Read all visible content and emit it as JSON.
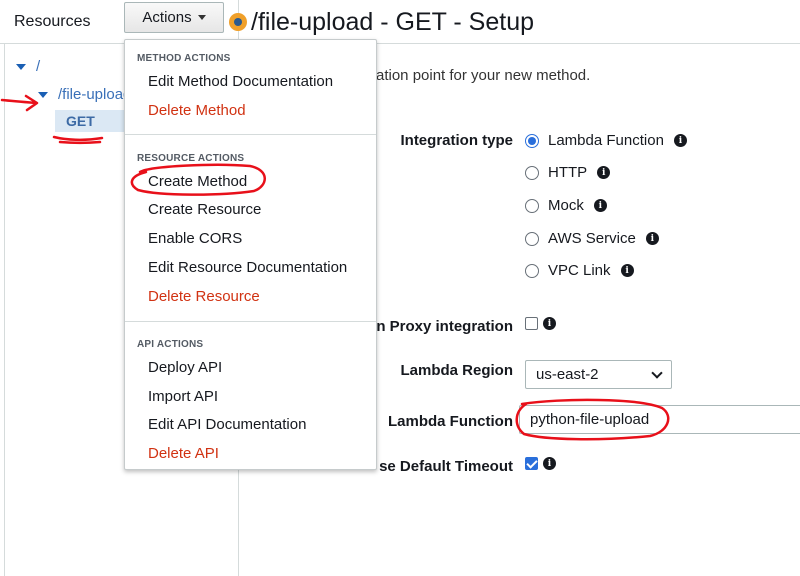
{
  "sidebar": {
    "title": "Resources",
    "root_path": "/",
    "child_path": "/file-upload",
    "method": "GET"
  },
  "header": {
    "actions_label": "Actions",
    "page_title": "/file-upload - GET - Setup"
  },
  "actions_menu": {
    "method_section": "METHOD ACTIONS",
    "edit_method_doc": "Edit Method Documentation",
    "delete_method": "Delete Method",
    "resource_section": "RESOURCE ACTIONS",
    "create_method": "Create Method",
    "create_resource": "Create Resource",
    "enable_cors": "Enable CORS",
    "edit_resource_doc": "Edit Resource Documentation",
    "delete_resource": "Delete Resource",
    "api_section": "API ACTIONS",
    "deploy_api": "Deploy API",
    "import_api": "Import API",
    "edit_api_doc": "Edit API Documentation",
    "delete_api": "Delete API"
  },
  "form": {
    "intro_fragment": "ation point for your new method.",
    "integration_type_label": "Integration type",
    "options": [
      "Lambda Function",
      "HTTP",
      "Mock",
      "AWS Service",
      "VPC Link"
    ],
    "selected_option": "Lambda Function",
    "proxy_label_fragment": "n Proxy integration",
    "proxy_checked": false,
    "region_label": "Lambda Region",
    "region_value": "us-east-2",
    "function_label": "Lambda Function",
    "function_value": "python-file-upload",
    "timeout_label_fragment": "se Default Timeout",
    "timeout_checked": true
  },
  "colors": {
    "link_blue": "#3a70b8",
    "danger_red": "#d13212",
    "radio_blue": "#2a6fdb",
    "annotation_red": "#e8101a",
    "status_orange": "#f0a02a"
  }
}
